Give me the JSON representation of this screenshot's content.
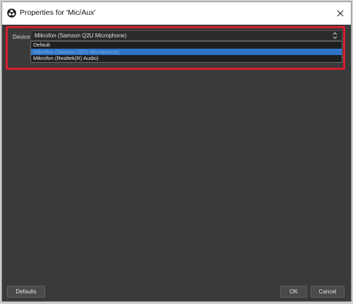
{
  "window": {
    "title": "Properties for 'Mic/Aux'"
  },
  "icons": {
    "app": "obs-logo-icon",
    "close": "close-icon",
    "select_arrows": "chevron-up-down-icon"
  },
  "colors": {
    "highlight_border": "#d51f2e",
    "selected_option": "#2e75c9",
    "background": "#3a3a3a"
  },
  "device": {
    "label": "Device",
    "selected_value": "Mikrofon (Samson Q2U Microphone)",
    "options": [
      "Default",
      "Mikrofon (Samson Q2U Microphone)",
      "Mikrofon (Realtek(R) Audio)"
    ]
  },
  "buttons": {
    "defaults": "Defaults",
    "ok": "OK",
    "cancel": "Cancel"
  }
}
